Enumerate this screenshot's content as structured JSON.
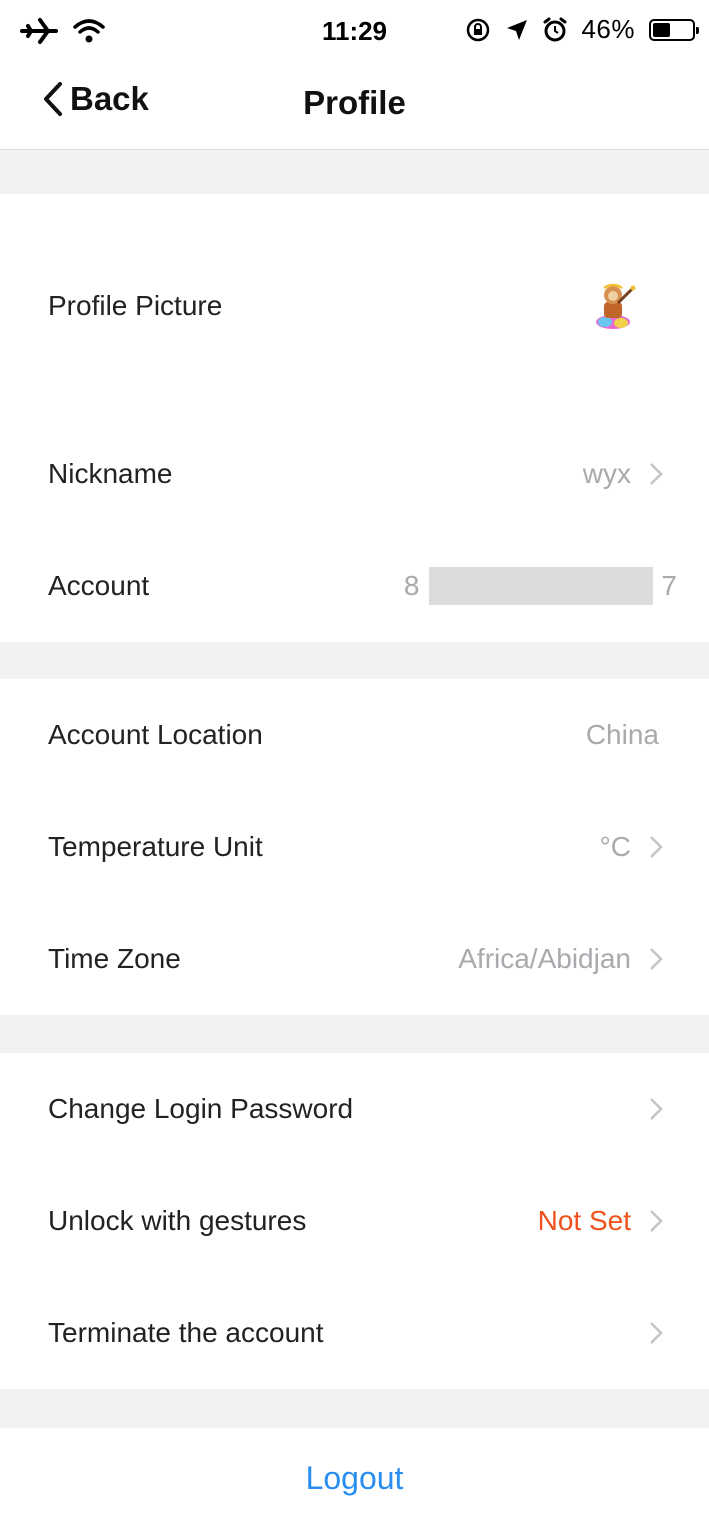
{
  "status_bar": {
    "time": "11:29",
    "battery_percent": "46%",
    "battery_level": 0.46,
    "icons": [
      "airplane-icon",
      "wifi-icon",
      "orientation-lock-icon",
      "location-arrow-icon",
      "alarm-icon",
      "battery-icon"
    ]
  },
  "nav": {
    "back_label": "Back",
    "title": "Profile"
  },
  "profile": {
    "picture_label": "Profile Picture",
    "nickname_label": "Nickname",
    "nickname_value": "wyx",
    "account_label": "Account",
    "account_value_visible": "8",
    "account_value_tail": "7"
  },
  "settings": {
    "location_label": "Account Location",
    "location_value": "China",
    "temp_label": "Temperature Unit",
    "temp_value": "°C",
    "timezone_label": "Time Zone",
    "timezone_value": "Africa/Abidjan"
  },
  "security": {
    "password_label": "Change Login Password",
    "gesture_label": "Unlock with gestures",
    "gesture_value": "Not Set",
    "terminate_label": "Terminate the account"
  },
  "logout_label": "Logout",
  "colors": {
    "accent_blue": "#2a8ef0",
    "warning_orange": "#f0521e",
    "secondary_text": "#a9a9ae",
    "background": "#f2f2f4"
  }
}
